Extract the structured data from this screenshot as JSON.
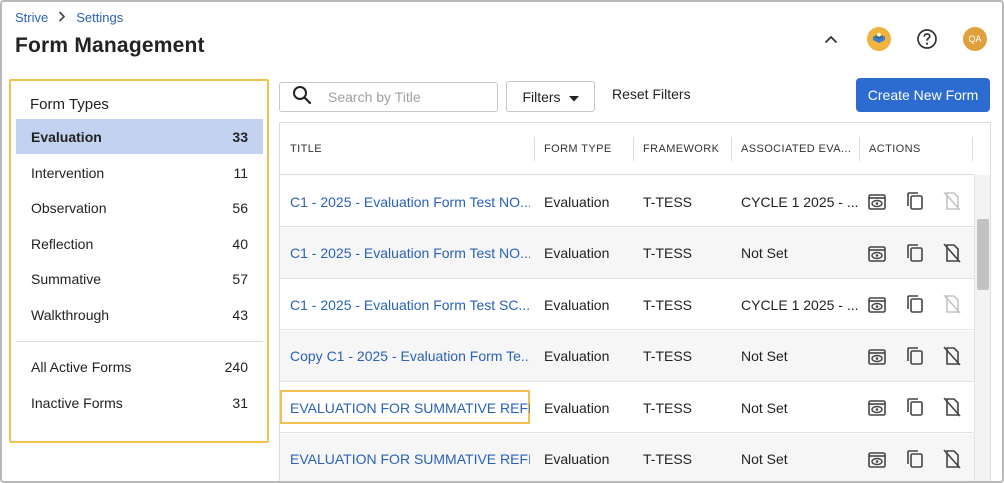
{
  "breadcrumb": {
    "root": "Strive",
    "current": "Settings"
  },
  "page_title": "Form Management",
  "header_icons": [
    "chevron-up-icon",
    "strive-logo-icon",
    "help-icon",
    "user-avatar"
  ],
  "avatar_initials": "QA",
  "form_types": {
    "title": "Form Types",
    "items": [
      {
        "label": "Evaluation",
        "count": "33",
        "active": true
      },
      {
        "label": "Intervention",
        "count": "11"
      },
      {
        "label": "Observation",
        "count": "56"
      },
      {
        "label": "Reflection",
        "count": "40"
      },
      {
        "label": "Summative",
        "count": "57"
      },
      {
        "label": "Walkthrough",
        "count": "43"
      }
    ],
    "extra": [
      {
        "label": "All Active Forms",
        "count": "240"
      },
      {
        "label": "Inactive Forms",
        "count": "31"
      }
    ]
  },
  "toolbar": {
    "search_placeholder": "Search by Title",
    "filters_label": "Filters",
    "reset_label": "Reset Filters",
    "create_label": "Create New Form"
  },
  "table": {
    "columns": [
      "TITLE",
      "FORM TYPE",
      "FRAMEWORK",
      "ASSOCIATED EVA...",
      "ACTIONS"
    ],
    "rows": [
      {
        "title": "C1 - 2025 - Evaluation Form Test NO...",
        "form_type": "Evaluation",
        "framework": "T-TESS",
        "associated": "CYCLE 1 2025 - ...",
        "delete_enabled": false
      },
      {
        "title": "C1 - 2025 - Evaluation Form Test NO...",
        "form_type": "Evaluation",
        "framework": "T-TESS",
        "associated": "Not Set",
        "delete_enabled": true
      },
      {
        "title": "C1 - 2025 - Evaluation Form Test SC...",
        "form_type": "Evaluation",
        "framework": "T-TESS",
        "associated": "CYCLE 1 2025 - ...",
        "delete_enabled": false
      },
      {
        "title": "Copy C1 - 2025 - Evaluation Form Te...",
        "form_type": "Evaluation",
        "framework": "T-TESS",
        "associated": "Not Set",
        "delete_enabled": true
      },
      {
        "title": "EVALUATION FOR SUMMATIVE REFI...",
        "form_type": "Evaluation",
        "framework": "T-TESS",
        "associated": "Not Set",
        "delete_enabled": true,
        "highlighted": true
      },
      {
        "title": "EVALUATION FOR SUMMATIVE REFI...",
        "form_type": "Evaluation",
        "framework": "T-TESS",
        "associated": "Not Set",
        "delete_enabled": true
      }
    ]
  },
  "colors": {
    "accent": "#2c6cd1",
    "link": "#2962b8",
    "highlight_border": "#f0c050",
    "active_row": "#c3d2f0",
    "avatar": "#e0a13c"
  }
}
